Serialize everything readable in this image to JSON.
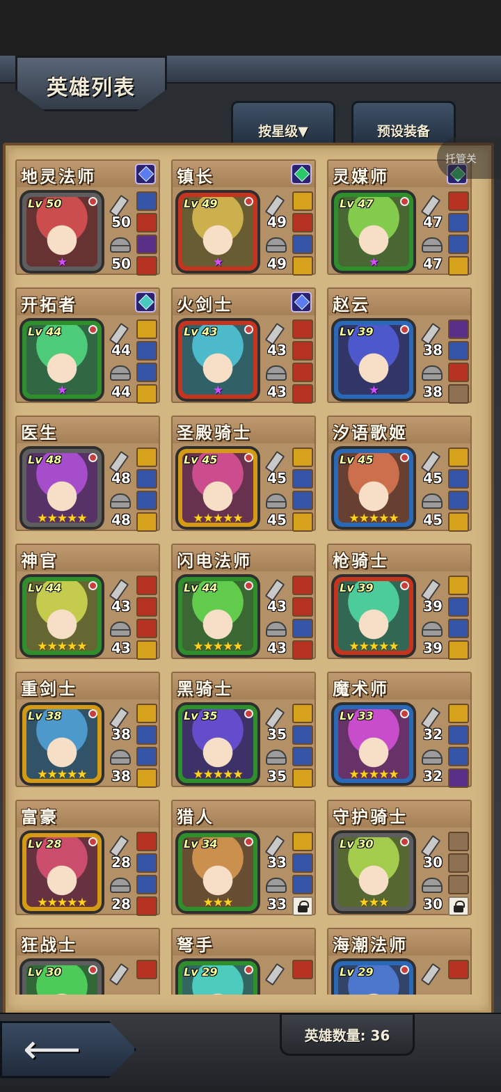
{
  "header": {
    "title": "英雄列表",
    "sort_button": "按星级▼",
    "equip_preset_button": "预设装备",
    "auto_button": "托管关"
  },
  "heroes": [
    {
      "name": "地灵法师",
      "level": "Lv 50",
      "attack": "50",
      "defense": "50",
      "gem": "blue",
      "frame": "gr",
      "stars": "★",
      "star_color": "purple",
      "equips": [
        "blue",
        "red",
        "purple",
        "red"
      ]
    },
    {
      "name": "镇长",
      "level": "Lv 49",
      "attack": "49",
      "defense": "49",
      "gem": "green",
      "frame": "r",
      "stars": "★",
      "star_color": "purple",
      "equips": [
        "yellow",
        "red",
        "blue",
        "yellow"
      ]
    },
    {
      "name": "灵媒师",
      "level": "Lv 47",
      "attack": "47",
      "defense": "47",
      "gem": "green",
      "frame": "g",
      "stars": "★",
      "star_color": "purple",
      "equips": [
        "red",
        "blue",
        "blue",
        "yellow"
      ]
    },
    {
      "name": "开拓者",
      "level": "Lv 44",
      "attack": "44",
      "defense": "44",
      "gem": "teal",
      "frame": "g",
      "stars": "★",
      "star_color": "purple",
      "equips": [
        "yellow",
        "blue",
        "blue",
        "yellow"
      ]
    },
    {
      "name": "火剑士",
      "level": "Lv 43",
      "attack": "43",
      "defense": "43",
      "gem": "blue",
      "frame": "r",
      "stars": "★",
      "star_color": "purple",
      "equips": [
        "red",
        "red",
        "red",
        "red"
      ]
    },
    {
      "name": "赵云",
      "level": "Lv 39",
      "attack": "38",
      "defense": "38",
      "gem": "",
      "frame": "b",
      "stars": "★",
      "star_color": "purple",
      "equips": [
        "purple",
        "blue",
        "red",
        "empty"
      ]
    },
    {
      "name": "医生",
      "level": "Lv 48",
      "attack": "48",
      "defense": "48",
      "gem": "",
      "frame": "gr",
      "stars": "★★★★★",
      "star_color": "gold",
      "equips": [
        "yellow",
        "blue",
        "blue",
        "yellow"
      ]
    },
    {
      "name": "圣殿骑士",
      "level": "Lv 45",
      "attack": "45",
      "defense": "45",
      "gem": "",
      "frame": "y",
      "stars": "★★★★★",
      "star_color": "gold",
      "equips": [
        "yellow",
        "blue",
        "blue",
        "yellow"
      ]
    },
    {
      "name": "汐语歌姬",
      "level": "Lv 45",
      "attack": "45",
      "defense": "45",
      "gem": "",
      "frame": "b",
      "stars": "★★★★★",
      "star_color": "gold",
      "equips": [
        "yellow",
        "blue",
        "blue",
        "yellow"
      ]
    },
    {
      "name": "神官",
      "level": "Lv 44",
      "attack": "43",
      "defense": "43",
      "gem": "",
      "frame": "g",
      "stars": "★★★★★",
      "star_color": "gold",
      "equips": [
        "red",
        "red",
        "red",
        "yellow"
      ]
    },
    {
      "name": "闪电法师",
      "level": "Lv 44",
      "attack": "43",
      "defense": "43",
      "gem": "",
      "frame": "g",
      "stars": "★★★★★",
      "star_color": "gold",
      "equips": [
        "red",
        "red",
        "blue",
        "red"
      ]
    },
    {
      "name": "枪骑士",
      "level": "Lv 39",
      "attack": "39",
      "defense": "39",
      "gem": "",
      "frame": "r",
      "stars": "★★★★★",
      "star_color": "gold",
      "equips": [
        "yellow",
        "blue",
        "blue",
        "yellow"
      ]
    },
    {
      "name": "重剑士",
      "level": "Lv 38",
      "attack": "38",
      "defense": "38",
      "gem": "",
      "frame": "y",
      "stars": "★★★★★",
      "star_color": "gold",
      "equips": [
        "yellow",
        "blue",
        "blue",
        "yellow"
      ]
    },
    {
      "name": "黑骑士",
      "level": "Lv 35",
      "attack": "35",
      "defense": "35",
      "gem": "",
      "frame": "g",
      "stars": "★★★★★",
      "star_color": "gold",
      "equips": [
        "yellow",
        "blue",
        "blue",
        "yellow"
      ]
    },
    {
      "name": "魔术师",
      "level": "Lv 33",
      "attack": "32",
      "defense": "32",
      "gem": "",
      "frame": "b",
      "stars": "★★★★★",
      "star_color": "gold",
      "equips": [
        "yellow",
        "blue",
        "blue",
        "purple"
      ]
    },
    {
      "name": "富豪",
      "level": "Lv 28",
      "attack": "28",
      "defense": "28",
      "gem": "",
      "frame": "y",
      "stars": "★★★★★",
      "star_color": "gold",
      "equips": [
        "red",
        "blue",
        "blue",
        "red"
      ]
    },
    {
      "name": "猎人",
      "level": "Lv 34",
      "attack": "33",
      "defense": "33",
      "gem": "",
      "frame": "g",
      "stars": "★★★",
      "star_color": "gold",
      "equips": [
        "yellow",
        "blue",
        "blue",
        "lock"
      ]
    },
    {
      "name": "守护骑士",
      "level": "Lv 30",
      "attack": "30",
      "defense": "30",
      "gem": "",
      "frame": "gr",
      "stars": "★★★",
      "star_color": "gold",
      "equips": [
        "empty",
        "empty",
        "empty",
        "lock"
      ]
    },
    {
      "name": "狂战士",
      "level": "Lv 30",
      "attack": "",
      "defense": "",
      "gem": "",
      "frame": "gr",
      "stars": "",
      "star_color": "gold",
      "equips": [
        "red"
      ]
    },
    {
      "name": "弩手",
      "level": "Lv 29",
      "attack": "",
      "defense": "",
      "gem": "",
      "frame": "g",
      "stars": "",
      "star_color": "gold",
      "equips": [
        "red"
      ]
    },
    {
      "name": "海潮法师",
      "level": "Lv 29",
      "attack": "",
      "defense": "",
      "gem": "",
      "frame": "b",
      "stars": "",
      "star_color": "gold",
      "equips": [
        "red"
      ]
    }
  ],
  "footer": {
    "back_icon": "arrow-left-icon",
    "back_glyph": "⟵",
    "hero_count": "英雄数量: 36"
  }
}
